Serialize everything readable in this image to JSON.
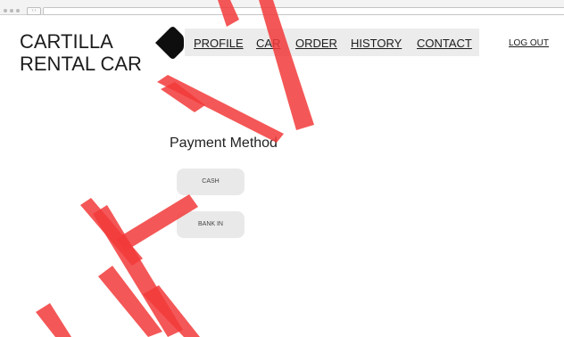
{
  "browser": {
    "nav_glyph": "‹ ›"
  },
  "header": {
    "logo_line1": "CARTILLA",
    "logo_line2": "RENTAL CAR",
    "back_icon": "back-arrow-icon"
  },
  "nav": {
    "items": [
      {
        "label": "PROFILE"
      },
      {
        "label": "CAR"
      },
      {
        "label": "ORDER"
      },
      {
        "label": "HISTORY"
      },
      {
        "label": "CONTACT"
      }
    ],
    "logout_label": "LOG OUT"
  },
  "main": {
    "title": "Payment Method",
    "options": [
      {
        "label": "CASH"
      },
      {
        "label": "BANK IN"
      }
    ]
  },
  "colors": {
    "watermark": "#f23a3a",
    "navbar_bg": "#ececec",
    "button_bg": "#e9e9e9"
  }
}
